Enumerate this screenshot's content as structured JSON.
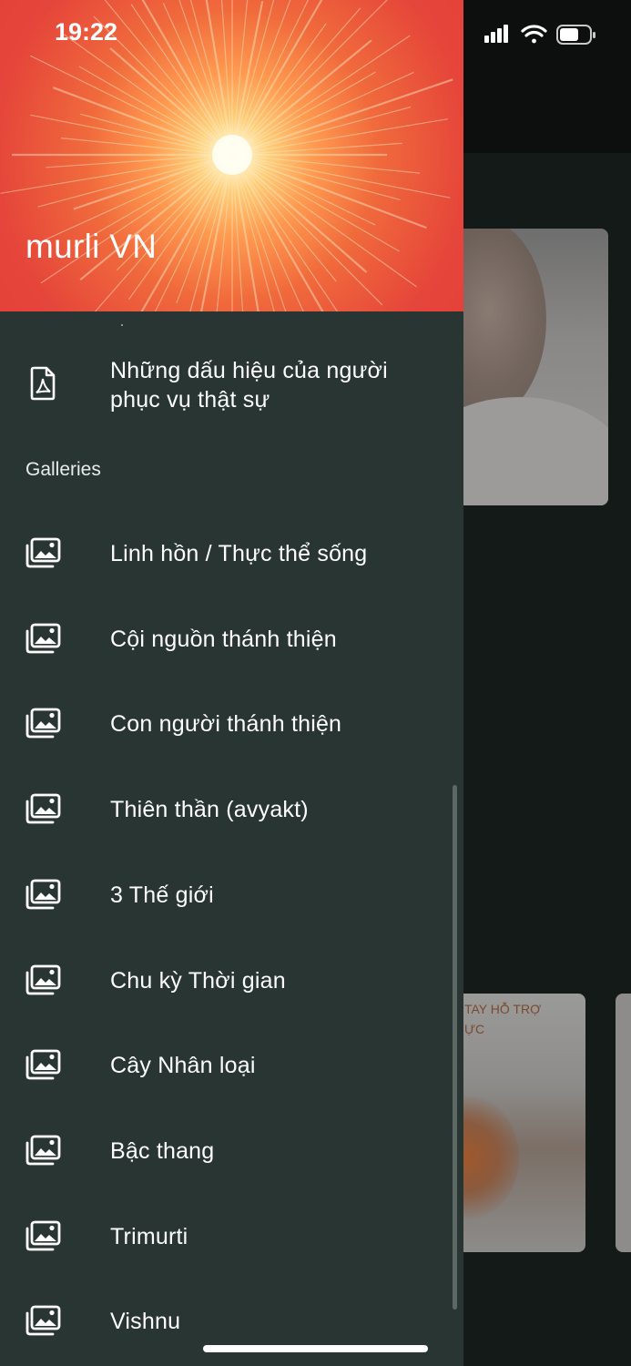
{
  "status_bar": {
    "time": "19:22"
  },
  "drawer": {
    "title": "murli VN",
    "top_item": {
      "icon": "pdf-icon",
      "label_line1": "Những dấu hiệu của người",
      "label_line2": "phục vụ thật sự"
    },
    "section_title": "Galleries",
    "items": [
      {
        "icon": "gallery-icon",
        "label": "Linh hồn / Thực thể sống"
      },
      {
        "icon": "gallery-icon",
        "label": "Cội nguồn thánh thiện"
      },
      {
        "icon": "gallery-icon",
        "label": "Con người thánh thiện"
      },
      {
        "icon": "gallery-icon",
        "label": "Thiên thần (avyakt)"
      },
      {
        "icon": "gallery-icon",
        "label": "3 Thế giới"
      },
      {
        "icon": "gallery-icon",
        "label": "Chu kỳ Thời gian"
      },
      {
        "icon": "gallery-icon",
        "label": "Cây Nhân loại"
      },
      {
        "icon": "gallery-icon",
        "label": "Bậc thang"
      },
      {
        "icon": "gallery-icon",
        "label": "Trimurti"
      },
      {
        "icon": "gallery-icon",
        "label": "Vishnu"
      }
    ]
  },
  "background": {
    "poster_text": "TAY HỖ TRỢ\nỰC"
  },
  "colors": {
    "drawer_bg": "#293532",
    "header_red": "#e23d37",
    "text": "#ffffff"
  }
}
